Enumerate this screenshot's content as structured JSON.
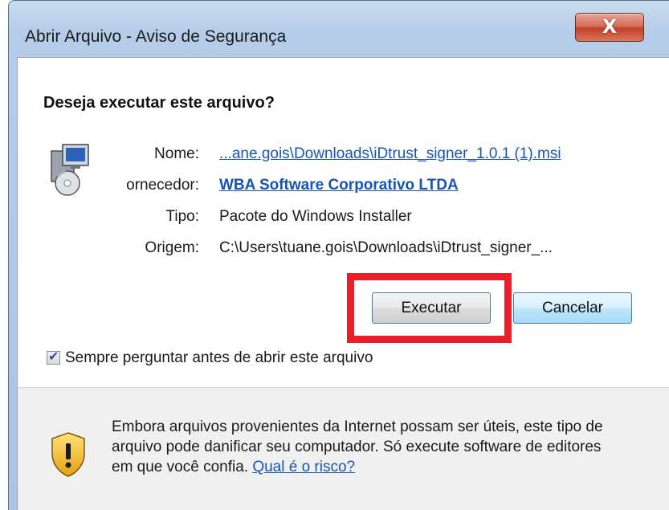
{
  "window": {
    "title": "Abrir Arquivo - Aviso de Segurança",
    "close_glyph": "X"
  },
  "dialog": {
    "question": "Deseja executar este arquivo?",
    "fields": {
      "name_label": "Nome:",
      "name_value": "...ane.gois\\Downloads\\iDtrust_signer_1.0.1 (1).msi",
      "publisher_label": "ornecedor:",
      "publisher_value": "WBA Software Corporativo LTDA",
      "type_label": "Tipo:",
      "type_value": "Pacote do Windows Installer",
      "origin_label": "Origem:",
      "origin_value": "C:\\Users\\tuane.gois\\Downloads\\iDtrust_signer_..."
    },
    "buttons": {
      "run_label": "Executar",
      "cancel_label": "Cancelar"
    },
    "checkbox": {
      "label": "Sempre perguntar antes de abrir este arquivo",
      "checked": true
    }
  },
  "footer": {
    "warning_text": "Embora arquivos provenientes da Internet possam ser úteis, este tipo de arquivo pode danificar seu computador. Só execute software de editores em que você confia.",
    "risk_link": "Qual é o risco?"
  },
  "colors": {
    "highlight": "#e8202a",
    "link": "#1655b5",
    "title_bar": "#b5cde8"
  },
  "icons": {
    "file": "installer-icon",
    "warning": "shield-warning-icon",
    "close": "close-icon",
    "check": "checkmark-icon"
  }
}
